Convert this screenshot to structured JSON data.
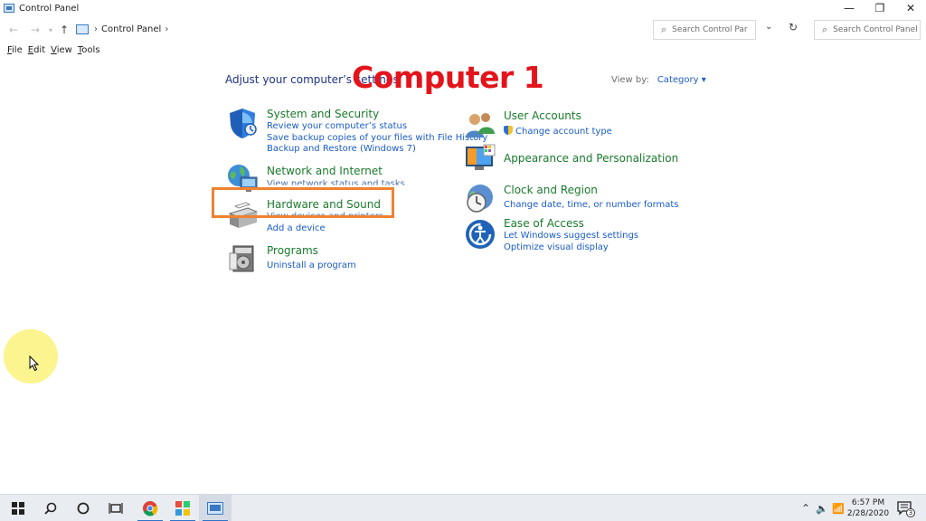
{
  "window": {
    "title": "Control Panel"
  },
  "window_controls": {
    "minimize": "—",
    "maximize": "❐",
    "close": "✕"
  },
  "address_bar": {
    "breadcrumb": "Control Panel",
    "search_placeholder": "Search Control Par"
  },
  "outer_search": {
    "placeholder": "Search Control Panel"
  },
  "menu": {
    "file": {
      "u": "F",
      "rest": "ile"
    },
    "edit": {
      "u": "E",
      "rest": "dit"
    },
    "view": {
      "u": "V",
      "rest": "iew"
    },
    "tools": {
      "u": "T",
      "rest": "ools"
    }
  },
  "page": {
    "heading": "Adjust your computer’s settings",
    "view_by_label": "View by:",
    "view_by_value": "Category"
  },
  "overlay_label": "Computer 1",
  "left_categories": [
    {
      "title": "System and Security",
      "links": [
        "Review your computer’s status",
        "Save backup copies of your files with File History",
        "Backup and Restore (Windows 7)"
      ]
    },
    {
      "title": "Network and Internet",
      "links": [
        "View network status and tasks"
      ]
    },
    {
      "title": "Hardware and Sound",
      "links": [
        "View devices and printers",
        "Add a device"
      ]
    },
    {
      "title": "Programs",
      "links": [
        "Uninstall a program"
      ]
    }
  ],
  "right_categories": [
    {
      "title": "User Accounts",
      "links": [
        "Change account type"
      ]
    },
    {
      "title": "Appearance and Personalization",
      "links": []
    },
    {
      "title": "Clock and Region",
      "links": [
        "Change date, time, or number formats"
      ]
    },
    {
      "title": "Ease of Access",
      "links": [
        "Let Windows suggest settings",
        "Optimize visual display"
      ]
    }
  ],
  "taskbar": {
    "time": "6:57 PM",
    "date": "2/28/2020",
    "notification_count": "3"
  },
  "colors": {
    "category_green": "#1a7a2d",
    "link_blue": "#1a5cc8",
    "highlight_orange": "#f08232",
    "overlay_red": "#e3141b"
  }
}
